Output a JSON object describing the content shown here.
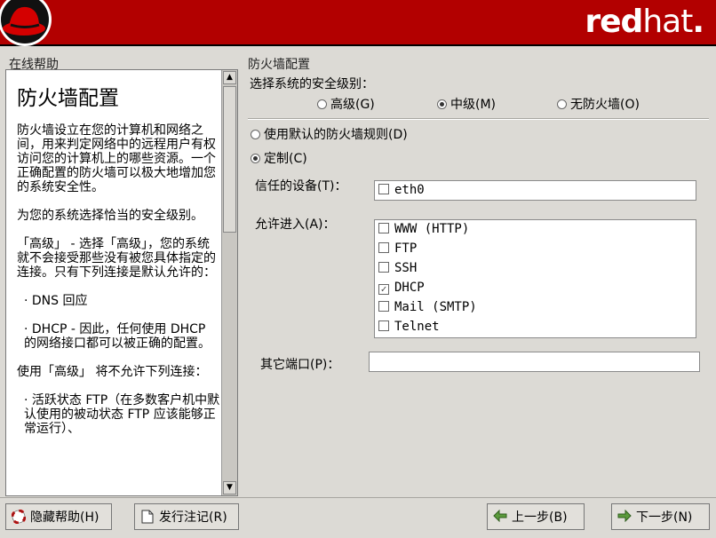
{
  "header": {
    "brand_bold": "red",
    "brand_thin": "hat",
    "brand_dot": "."
  },
  "help": {
    "group_title": "在线帮助",
    "heading": "防火墙配置",
    "paragraphs": [
      "防火墙设立在您的计算机和网络之间，用来判定网络中的远程用户有权访问您的计算机上的哪些资源。一个正确配置的防火墙可以极大地增加您的系统安全性。",
      "为您的系统选择恰当的安全级别。",
      "「高级」 - 选择「高级」，您的系统就不会接受那些没有被您具体指定的连接。只有下列连接是默认允许的：",
      "· DNS 回应",
      "· DHCP - 因此，任何使用 DHCP 的网络接口都可以被正确的配置。",
      "使用「高级」 将不允许下列连接：",
      "· 活跃状态 FTP（在多数客户机中默认使用的被动状态 FTP 应该能够正常运行）、"
    ]
  },
  "config": {
    "group_title": "防火墙配置",
    "security_label": "选择系统的安全级别：",
    "levels": [
      {
        "label": "高级(G)",
        "selected": false
      },
      {
        "label": "中级(M)",
        "selected": true
      },
      {
        "label": "无防火墙(O)",
        "selected": false
      }
    ],
    "default_rules_label": "使用默认的防火墙规则(D)",
    "custom_label": "定制(C)",
    "trusted_label": "信任的设备(T)：",
    "trusted_devices": [
      {
        "label": "eth0",
        "checked": false
      }
    ],
    "allow_label": "允许进入(A)：",
    "allow_items": [
      {
        "label": "WWW (HTTP)",
        "checked": false
      },
      {
        "label": "FTP",
        "checked": false
      },
      {
        "label": "SSH",
        "checked": false
      },
      {
        "label": "DHCP",
        "checked": true
      },
      {
        "label": "Mail (SMTP)",
        "checked": false
      },
      {
        "label": "Telnet",
        "checked": false
      }
    ],
    "other_ports_label": "其它端口(P)：",
    "other_ports_value": ""
  },
  "buttons": {
    "hide_help": "隐藏帮助(H)",
    "release_notes": "发行注记(R)",
    "back": "上一步(B)",
    "next": "下一步(N)"
  }
}
